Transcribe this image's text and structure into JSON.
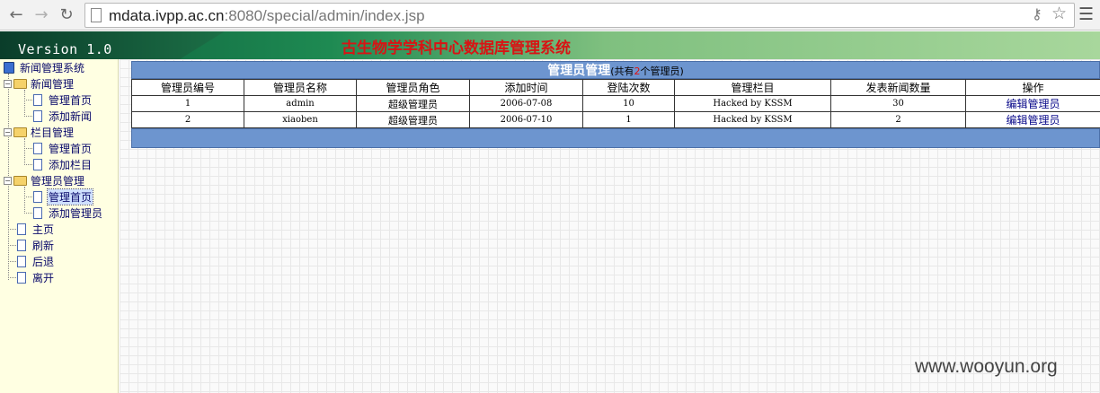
{
  "browser": {
    "url_host": "mdata.ivpp.ac.cn",
    "url_rest": ":8080/special/admin/index.jsp"
  },
  "header": {
    "version": "Version 1.0",
    "title": "古生物学学科中心数据库管理系统"
  },
  "sidebar": {
    "root": "新闻管理系统",
    "groups": [
      {
        "label": "新闻管理",
        "items": [
          "管理首页",
          "添加新闻"
        ]
      },
      {
        "label": "栏目管理",
        "items": [
          "管理首页",
          "添加栏目"
        ]
      },
      {
        "label": "管理员管理",
        "items": [
          "管理首页",
          "添加管理员"
        ]
      }
    ],
    "links": [
      "主页",
      "刷新",
      "后退",
      "离开"
    ]
  },
  "panel": {
    "title": "管理员管理",
    "count_prefix": "(共有",
    "count": "2",
    "count_suffix": "个管理员)",
    "columns": [
      "管理员编号",
      "管理员名称",
      "管理员角色",
      "添加时间",
      "登陆次数",
      "管理栏目",
      "发表新闻数量",
      "操作"
    ],
    "rows": [
      [
        "1",
        "admin",
        "超级管理员",
        "2006-07-08",
        "10",
        "Hacked by KSSM",
        "30",
        "编辑管理员"
      ],
      [
        "2",
        "xiaoben",
        "超级管理员",
        "2006-07-10",
        "1",
        "Hacked by KSSM",
        "2",
        "编辑管理员"
      ]
    ]
  },
  "watermark": "www.wooyun.org",
  "colors": {
    "title_red": "#d81414",
    "panel_blue": "#6d95cf",
    "sidebar_bg": "#ffffe2"
  }
}
